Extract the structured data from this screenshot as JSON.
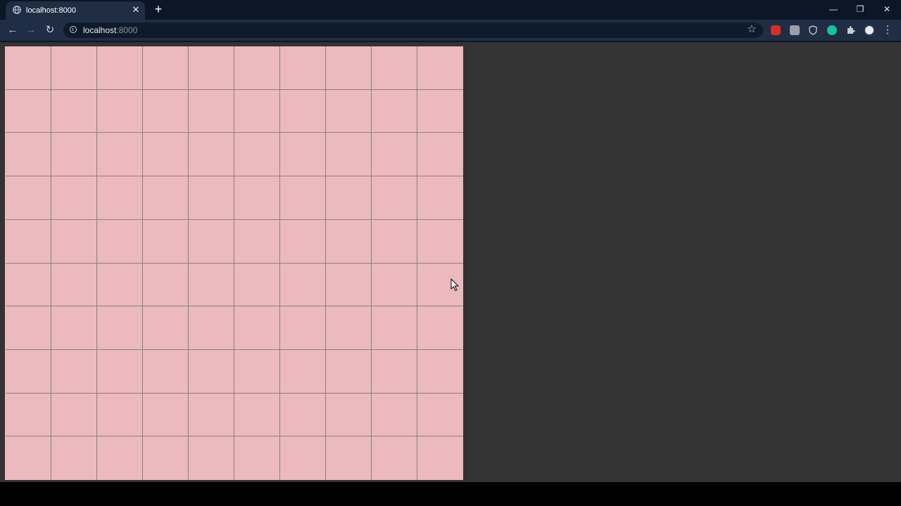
{
  "browser": {
    "tab": {
      "title": "localhost:8000",
      "close_label": "✕"
    },
    "new_tab_label": "+",
    "window_controls": {
      "minimize": "—",
      "restore": "❐",
      "close": "✕"
    },
    "nav": {
      "back": "←",
      "forward": "→",
      "reload": "↻"
    },
    "address": {
      "host": "localhost",
      "port": ":8000"
    },
    "bookmark_star": "☆",
    "extensions": [
      {
        "name": "red-shield-extension-icon",
        "color": "#d93025"
      },
      {
        "name": "k-extension-icon",
        "color": "#9aa0a6"
      },
      {
        "name": "v-shield-extension-icon",
        "color": "#c7ccd4"
      },
      {
        "name": "grammarly-extension-icon",
        "color": "#15c39a"
      },
      {
        "name": "puzzle-extensions-icon",
        "color": "#c7ccd4"
      },
      {
        "name": "profile-avatar",
        "color": "#e8eaed"
      }
    ],
    "menu_label": "⋮"
  },
  "page": {
    "background": "#333333",
    "grid": {
      "rows": 10,
      "columns": 10,
      "cell_color": "#ecb9bd",
      "line_color": "#8c7f80"
    }
  }
}
